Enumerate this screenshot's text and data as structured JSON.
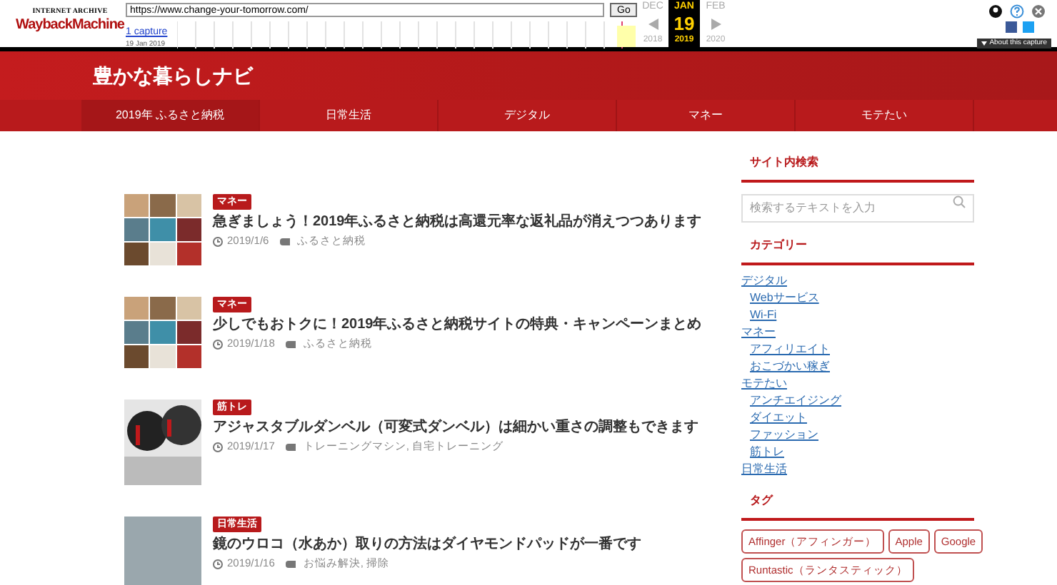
{
  "wayback": {
    "logo_top": "INTERNET ARCHIVE",
    "logo": "WaybackMachine",
    "url": "https://www.change-your-tomorrow.com/",
    "go": "Go",
    "captures": "1 capture",
    "capture_date": "19 Jan 2019",
    "months": [
      {
        "label": "DEC",
        "selected": false
      },
      {
        "label": "JAN",
        "selected": true
      },
      {
        "label": "FEB",
        "selected": false
      }
    ],
    "day": "19",
    "years": [
      {
        "label": "2018",
        "selected": false
      },
      {
        "label": "2019",
        "selected": true
      },
      {
        "label": "2020",
        "selected": false
      }
    ],
    "about": "About this capture"
  },
  "site": {
    "title": "豊かな暮らしナビ"
  },
  "nav": [
    {
      "label": "2019年 ふるさと納税",
      "selected": true
    },
    {
      "label": "日常生活",
      "selected": false
    },
    {
      "label": "デジタル",
      "selected": false
    },
    {
      "label": "マネー",
      "selected": false
    },
    {
      "label": "モテたい",
      "selected": false
    }
  ],
  "articles": [
    {
      "category": "マネー",
      "title": "急ぎましょう！2019年ふるさと納税は高還元率な返礼品が消えつつあります",
      "date": "2019/1/6",
      "tags": "ふるさと納税",
      "kind": "food"
    },
    {
      "category": "マネー",
      "title": "少しでもおトクに！2019年ふるさと納税サイトの特典・キャンペーンまとめ",
      "date": "2019/1/18",
      "tags": "ふるさと納税",
      "kind": "food"
    },
    {
      "category": "筋トレ",
      "title": "アジャスタブルダンベル（可変式ダンベル）は細かい重さの調整もできます",
      "date": "2019/1/17",
      "tags": "トレーニングマシン, 自宅トレーニング",
      "kind": "dumbbell"
    },
    {
      "category": "日常生活",
      "title": "鏡のウロコ（水あか）取りの方法はダイヤモンドパッドが一番です",
      "date": "2019/1/16",
      "tags": "お悩み解決, 掃除",
      "kind": "photo"
    }
  ],
  "sidebar": {
    "search_heading": "サイト内検索",
    "search_placeholder": "検索するテキストを入力",
    "category_heading": "カテゴリー",
    "categories": [
      {
        "label": "デジタル",
        "children": [
          {
            "label": "Webサービス"
          },
          {
            "label": "Wi-Fi"
          }
        ]
      },
      {
        "label": "マネー",
        "children": [
          {
            "label": "アフィリエイト"
          },
          {
            "label": "おこづかい稼ぎ"
          }
        ]
      },
      {
        "label": "モテたい",
        "children": [
          {
            "label": "アンチエイジング"
          },
          {
            "label": "ダイエット"
          },
          {
            "label": "ファッション"
          },
          {
            "label": "筋トレ"
          }
        ]
      },
      {
        "label": "日常生活"
      }
    ],
    "tag_heading": "タグ",
    "tags": [
      "Affinger（アフィンガー）",
      "Apple",
      "Google",
      "Runtastic（ランタスティック）"
    ]
  }
}
